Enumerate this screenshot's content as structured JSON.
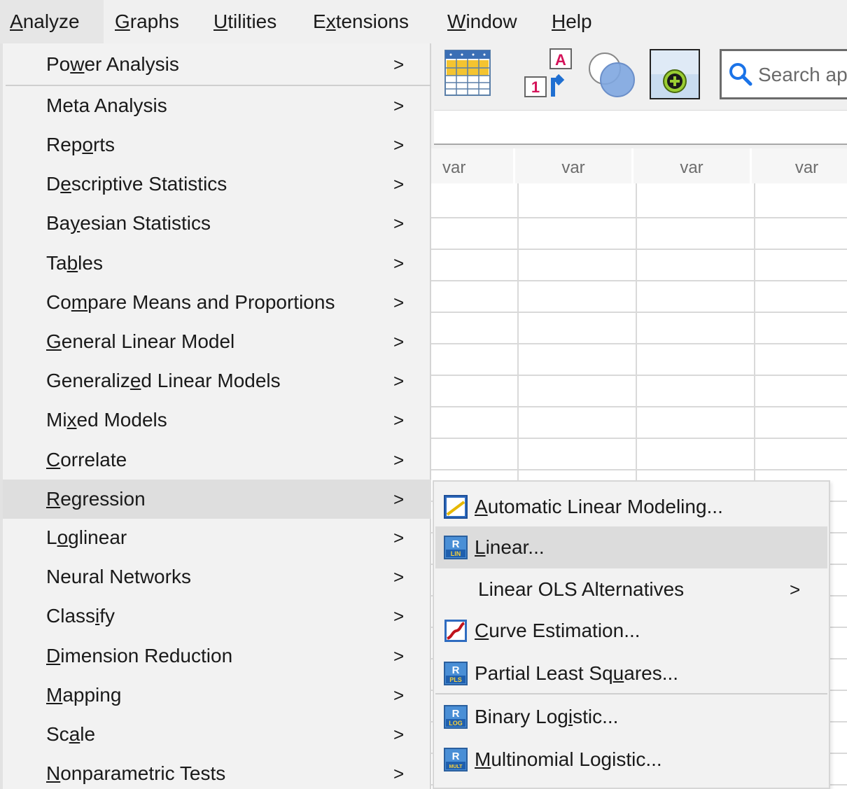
{
  "menubar": {
    "items": [
      {
        "label": "Analyze",
        "mnemonic": 0
      },
      {
        "label": "Graphs",
        "mnemonic": 0
      },
      {
        "label": "Utilities",
        "mnemonic": 0
      },
      {
        "label": "Extensions",
        "mnemonic": 1
      },
      {
        "label": "Window",
        "mnemonic": 0
      },
      {
        "label": "Help",
        "mnemonic": 0
      }
    ]
  },
  "toolbar": {
    "search_placeholder": "Search ap"
  },
  "grid": {
    "column_headers": [
      "var",
      "var",
      "var",
      "var"
    ]
  },
  "analyze_menu": {
    "items": [
      {
        "label": "Power Analysis",
        "mnemonic": 2
      },
      {
        "label": "Meta Analysis",
        "mnemonic": -1
      },
      {
        "label": "Reports",
        "mnemonic": 3
      },
      {
        "label": "Descriptive Statistics",
        "mnemonic": 1
      },
      {
        "label": "Bayesian Statistics",
        "mnemonic": 2
      },
      {
        "label": "Tables",
        "mnemonic": 2
      },
      {
        "label": "Compare Means and Proportions",
        "mnemonic": 2
      },
      {
        "label": "General Linear Model",
        "mnemonic": 0
      },
      {
        "label": "Generalized Linear Models",
        "mnemonic": 9
      },
      {
        "label": "Mixed Models",
        "mnemonic": 2
      },
      {
        "label": "Correlate",
        "mnemonic": 0
      },
      {
        "label": "Regression",
        "mnemonic": 0
      },
      {
        "label": "Loglinear",
        "mnemonic": 1
      },
      {
        "label": "Neural Networks",
        "mnemonic": -1
      },
      {
        "label": "Classify",
        "mnemonic": 5
      },
      {
        "label": "Dimension Reduction",
        "mnemonic": 0
      },
      {
        "label": "Mapping",
        "mnemonic": 0
      },
      {
        "label": "Scale",
        "mnemonic": 2
      },
      {
        "label": "Nonparametric Tests",
        "mnemonic": 0
      }
    ],
    "highlighted": "Regression",
    "arrow": ">"
  },
  "regression_submenu": {
    "items": [
      {
        "label": "Automatic Linear Modeling...",
        "mnemonic": 0,
        "icon": "automatic-linear-modeling-icon"
      },
      {
        "label": "Linear...",
        "mnemonic": 0,
        "icon": "r-lin-icon"
      },
      {
        "label": "Linear OLS Alternatives",
        "mnemonic": -1,
        "icon": "",
        "arrow": ">"
      },
      {
        "label": "Curve Estimation...",
        "mnemonic": 0,
        "icon": "curve-estimation-icon"
      },
      {
        "label": "Partial Least Squares...",
        "mnemonic": 16,
        "icon": "r-pls-icon"
      },
      {
        "label": "Binary Logistic...",
        "mnemonic": 10,
        "icon": "r-log-icon"
      },
      {
        "label": "Multinomial Logistic...",
        "mnemonic": 0,
        "icon": "r-mult-icon"
      }
    ],
    "highlighted": "Linear...",
    "icon_badges": {
      "lin": "LIN",
      "pls": "PLS",
      "log": "LOG",
      "mult": "MULT",
      "r": "R"
    }
  },
  "colors": {
    "menu_bg": "#f2f2f2",
    "highlight": "#dedede",
    "grid_line": "#d9d9d9",
    "search_icon": "#1a73e8"
  }
}
